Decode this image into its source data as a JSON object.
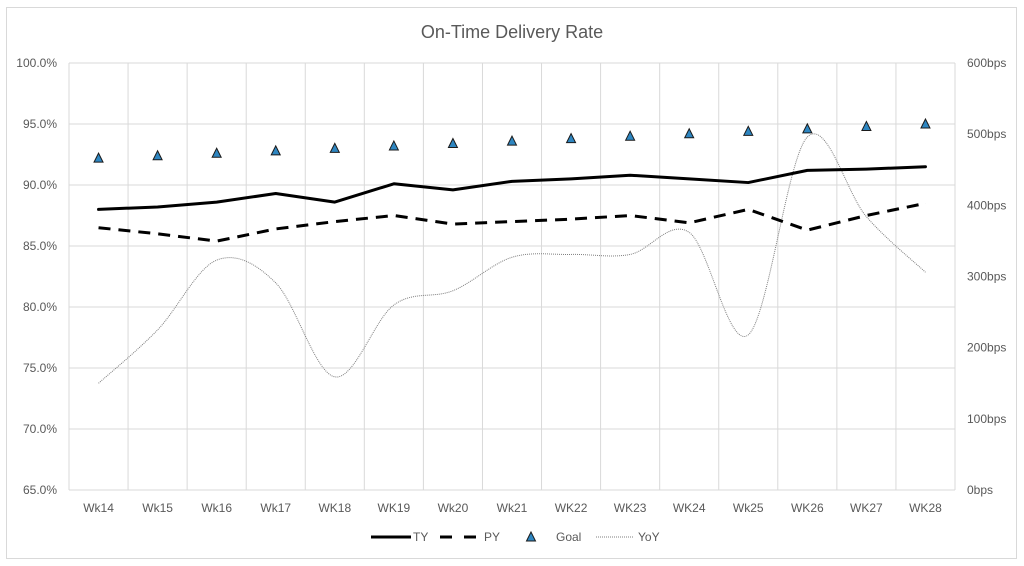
{
  "chart_data": {
    "type": "line",
    "title": "On-Time Delivery Rate",
    "xlabel": "",
    "ylabel": "",
    "y2label": "",
    "categories": [
      "Wk14",
      "Wk15",
      "Wk16",
      "Wk17",
      "WK18",
      "WK19",
      "Wk20",
      "Wk21",
      "WK22",
      "WK23",
      "WK24",
      "Wk25",
      "WK26",
      "WK27",
      "WK28"
    ],
    "ylim": [
      65.0,
      100.0
    ],
    "y_ticks": [
      65.0,
      70.0,
      75.0,
      80.0,
      85.0,
      90.0,
      95.0,
      100.0
    ],
    "y_tick_labels": [
      "65.0%",
      "70.0%",
      "75.0%",
      "80.0%",
      "85.0%",
      "90.0%",
      "95.0%",
      "100.0%"
    ],
    "y2lim": [
      0,
      600
    ],
    "y2_ticks": [
      0,
      100,
      200,
      300,
      400,
      500,
      600
    ],
    "y2_tick_labels": [
      "0bps",
      "100bps",
      "200bps",
      "300bps",
      "400bps",
      "500bps",
      "600bps"
    ],
    "grid": true,
    "legend_position": "bottom",
    "series": [
      {
        "name": "TY",
        "axis": "left",
        "style": "solid",
        "color": "#000000",
        "values": [
          88.0,
          88.2,
          88.6,
          89.3,
          88.6,
          90.1,
          89.6,
          90.3,
          90.5,
          90.8,
          90.5,
          90.2,
          91.2,
          91.3,
          91.5
        ]
      },
      {
        "name": "PY",
        "axis": "left",
        "style": "dashed",
        "color": "#000000",
        "values": [
          86.5,
          86.0,
          85.4,
          86.4,
          87.0,
          87.5,
          86.8,
          87.0,
          87.2,
          87.5,
          86.9,
          88.0,
          86.3,
          87.5,
          88.5
        ]
      },
      {
        "name": "Goal",
        "axis": "left",
        "style": "marker-triangle",
        "color": "#2e86c1",
        "values": [
          92.2,
          92.4,
          92.6,
          92.8,
          93.0,
          93.2,
          93.4,
          93.6,
          93.8,
          94.0,
          94.2,
          94.4,
          94.6,
          94.8,
          95.0
        ]
      },
      {
        "name": "YoY",
        "axis": "right",
        "style": "dotted-smooth",
        "color": "#7f7f7f",
        "values": [
          150,
          225,
          323,
          291,
          159,
          260,
          280,
          327,
          331,
          331,
          362,
          218,
          496,
          384,
          306
        ]
      }
    ]
  }
}
